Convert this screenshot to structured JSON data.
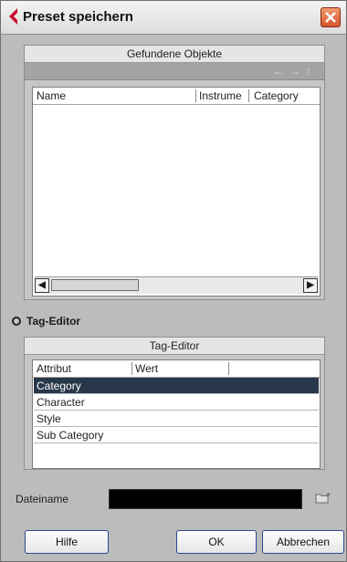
{
  "window": {
    "title": "Preset speichern"
  },
  "found_objects": {
    "title": "Gefundene Objekte",
    "columns": [
      "Name",
      "Instrume",
      "Category"
    ],
    "nav_icons": [
      "arrow-left-icon",
      "arrow-right-icon",
      "arrow-up-icon"
    ]
  },
  "tag_editor_toggle": {
    "label": "Tag-Editor"
  },
  "tag_editor": {
    "title": "Tag-Editor",
    "columns": [
      "Attribut",
      "Wert"
    ],
    "rows": [
      "Category",
      "Character",
      "Style",
      "Sub Category"
    ],
    "selected_index": 0
  },
  "filename": {
    "label": "Dateiname",
    "value": ""
  },
  "buttons": {
    "help": "Hilfe",
    "ok": "OK",
    "cancel": "Abbrechen"
  },
  "colors": {
    "selection": "#28384a",
    "title_icon": "#c8102e",
    "close": "#d4552a"
  }
}
